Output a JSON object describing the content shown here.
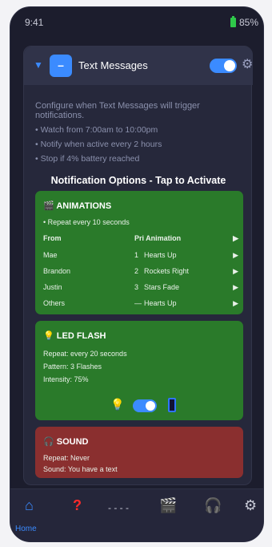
{
  "status": {
    "time": "9:41",
    "battery": "85%"
  },
  "header": {
    "title": "Text Messages",
    "app_glyph": "–",
    "toggle_on": true
  },
  "description": "Configure when Text Messages will trigger notifications.",
  "bullets": [
    "• Watch from 7:00am to 10:00pm",
    "• Notify when active every 2 hours",
    "• Stop if 4% battery reached"
  ],
  "options_title": "Notification Options - Tap to Activate",
  "animations": {
    "title": "ANIMATIONS",
    "icon": "clapperboard-icon",
    "repeat": "• Repeat every 10 seconds",
    "col_from": "From",
    "col_pri_anim": "Pri Animation",
    "rows": [
      {
        "from": "Mae",
        "pri": "1",
        "anim": "Hearts Up"
      },
      {
        "from": "Brandon",
        "pri": "2",
        "anim": "Rockets Right"
      },
      {
        "from": "Justin",
        "pri": "3",
        "anim": "Stars Fade"
      },
      {
        "from": "Others",
        "pri": "—",
        "anim": "Hearts Up"
      }
    ]
  },
  "led": {
    "title": "LED FLASH",
    "repeat": "Repeat: every 20 seconds",
    "pattern": "Pattern: 3 Flashes",
    "intensity": "Intensity: 75%",
    "toggle_on": true
  },
  "sound": {
    "title": "SOUND",
    "repeat": "Repeat: Never",
    "sound": "Sound: You have a text"
  },
  "nav": {
    "home_label": "Home",
    "dashes": "- - - -"
  },
  "colors": {
    "accent": "#3b8bff",
    "green": "#2a7a2a",
    "red": "#8a2f2f",
    "bg": "#1c1d2d"
  }
}
